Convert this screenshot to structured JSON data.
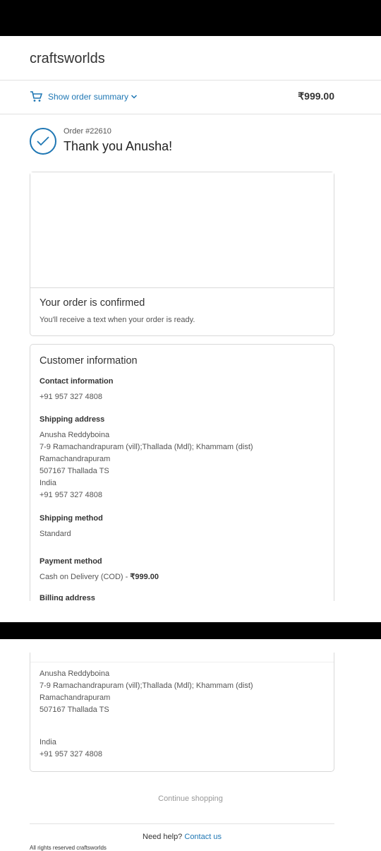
{
  "store": {
    "name": "craftsworlds"
  },
  "summary": {
    "toggle_label": "Show order summary",
    "total": "₹999.00"
  },
  "order": {
    "number": "Order #22610",
    "thanks": "Thank you Anusha!"
  },
  "confirmation": {
    "title": "Your order is confirmed",
    "note": "You'll receive a text when your order is ready."
  },
  "customer": {
    "title": "Customer information",
    "contact_label": "Contact information",
    "contact_value": "+91 957 327 4808",
    "shipping_label": "Shipping address",
    "shipping_lines": [
      "Anusha Reddyboina",
      "7-9 Ramachandrapuram (vill);Thallada (Mdl); Khammam (dist)",
      "Ramachandrapuram",
      "507167 Thallada TS",
      "India",
      "+91 957 327 4808"
    ],
    "method_label": "Shipping method",
    "method_value": "Standard",
    "payment_label": "Payment method",
    "payment_value": "Cash on Delivery (COD) - ",
    "payment_amount": "₹999.00",
    "billing_label": "Billing address",
    "billing_lines": [
      "Anusha Reddyboina",
      "7-9 Ramachandrapuram (vill);Thallada (Mdl); Khammam (dist)",
      "Ramachandrapuram",
      "507167 Thallada TS",
      "India",
      "+91 957 327 4808"
    ]
  },
  "footer": {
    "continue": "Continue shopping",
    "help_prefix": "Need help?",
    "help_link": "Contact us",
    "rights": "All rights reserved craftsworlds"
  },
  "colors": {
    "accent": "#1f77b4"
  }
}
